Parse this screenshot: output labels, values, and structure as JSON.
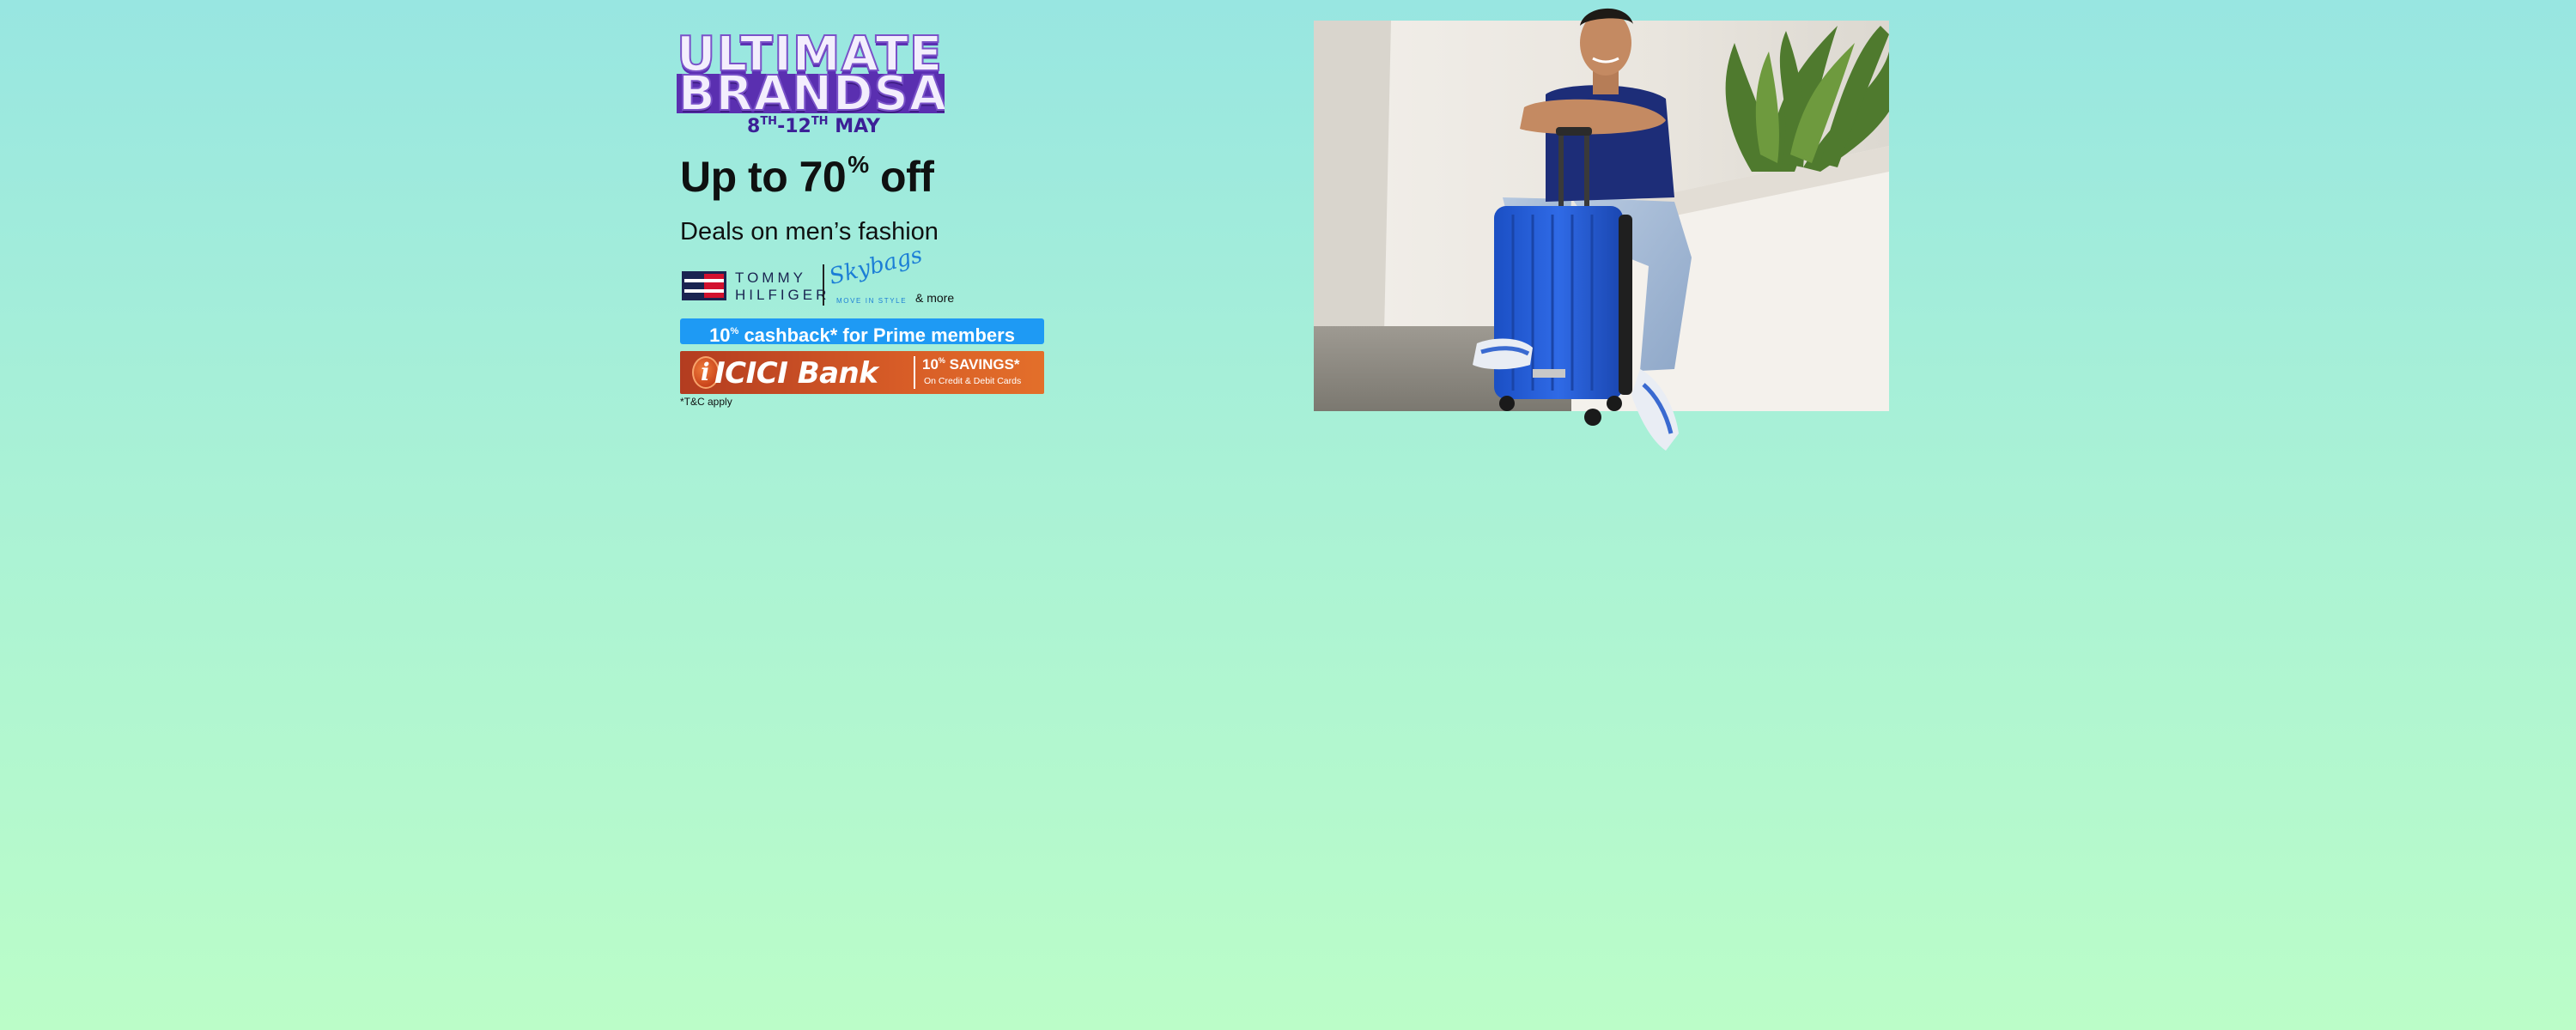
{
  "banner": {
    "sale_logo": {
      "line1": "ULTIMATE",
      "line2": "BRANDSALE",
      "date_start": "8",
      "date_start_suffix": "TH",
      "date_sep": "-12",
      "date_end_suffix": "TH",
      "date_month": " MAY"
    },
    "headline": {
      "prefix": "Up to 70",
      "percent": "%",
      "suffix": " off"
    },
    "subhead": "Deals on men’s fashion",
    "brands": {
      "tommy_hilfiger": "TOMMY\nHILFIGER",
      "skybags": "Skybags",
      "skybags_tagline": "MOVE IN STYLE",
      "and_more": "& more"
    },
    "cashback": {
      "value": "10",
      "percent": "%",
      "text": " cashback* for Prime members",
      "color": "#1e9af4"
    },
    "bank_offer": {
      "logo_letter": "i",
      "bank_name": "ICICI Bank",
      "savings_value": "10",
      "savings_percent": "%",
      "savings_text": " SAVINGS*",
      "cards_text": "On Credit & Debit Cards",
      "color": "#d75c27"
    },
    "tnc": "*T&C apply",
    "colors": {
      "background_top": "#98e6e1",
      "background_bottom": "#bbfdc8",
      "sale_purple": "#5a2fb0"
    },
    "hero_image": "man-sitting-with-blue-suitcase"
  }
}
